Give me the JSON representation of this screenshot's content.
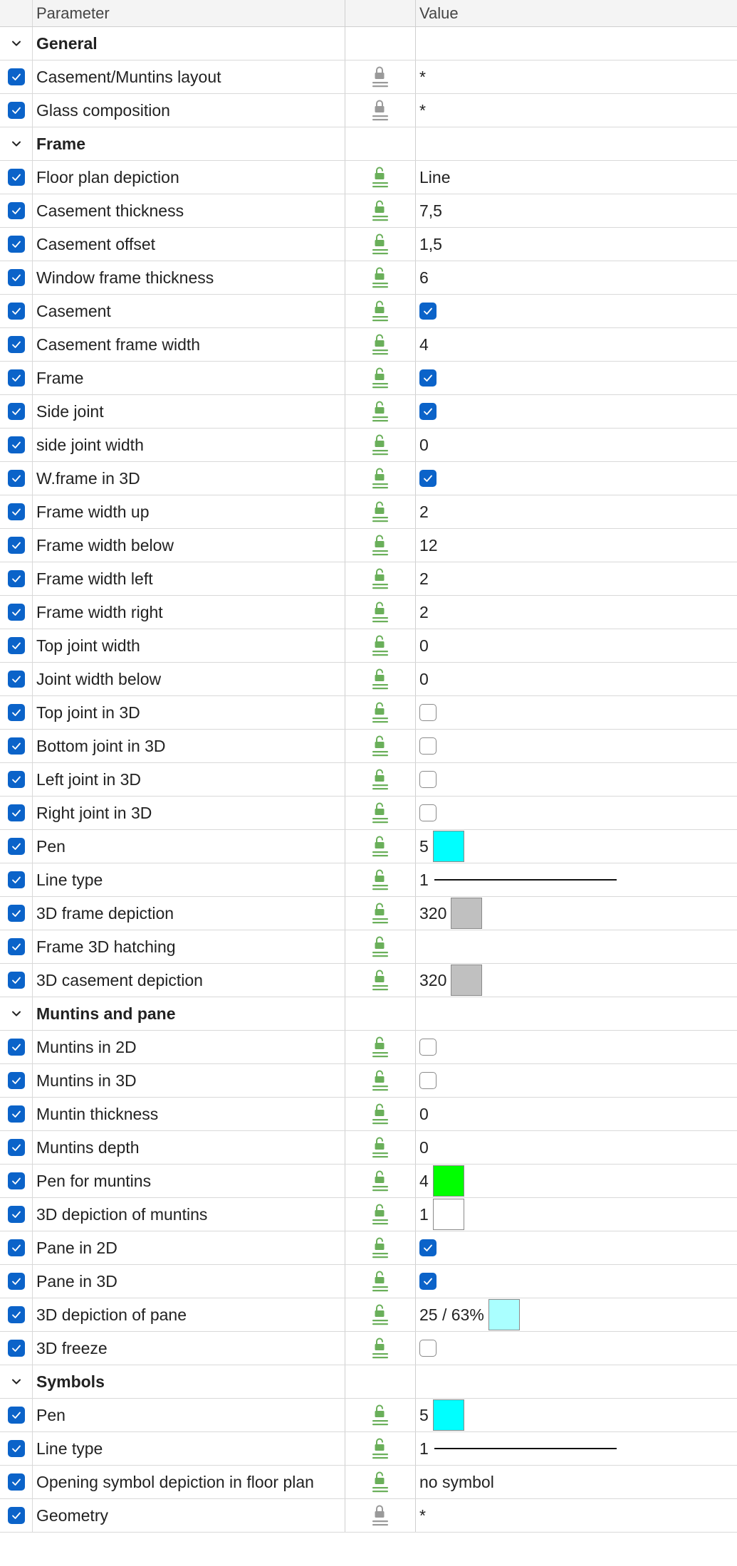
{
  "header": {
    "parameter": "Parameter",
    "value": "Value"
  },
  "colors": {
    "accent": "#0b63c9",
    "lock_unlocked": "#6aaf5a",
    "lock_locked": "#9a9a9a"
  },
  "rows": [
    {
      "kind": "group",
      "name": "General"
    },
    {
      "kind": "param",
      "name": "Casement/Muntins layout",
      "lock": "locked",
      "value": "*"
    },
    {
      "kind": "param",
      "name": "Glass composition",
      "lock": "locked",
      "value": "*"
    },
    {
      "kind": "group",
      "name": "Frame"
    },
    {
      "kind": "param",
      "name": "Floor plan depiction",
      "lock": "unlocked",
      "value": "Line"
    },
    {
      "kind": "param",
      "name": "Casement thickness",
      "lock": "unlocked",
      "value": "7,5"
    },
    {
      "kind": "param",
      "name": "Casement offset",
      "lock": "unlocked",
      "value": "1,5"
    },
    {
      "kind": "param",
      "name": "Window frame thickness",
      "lock": "unlocked",
      "value": "6"
    },
    {
      "kind": "param",
      "name": "Casement",
      "lock": "unlocked",
      "checkbox": true
    },
    {
      "kind": "param",
      "name": "Casement frame width",
      "lock": "unlocked",
      "value": "4"
    },
    {
      "kind": "param",
      "name": "Frame",
      "lock": "unlocked",
      "checkbox": true
    },
    {
      "kind": "param",
      "name": "Side joint",
      "lock": "unlocked",
      "checkbox": true
    },
    {
      "kind": "param",
      "name": "side joint width",
      "lock": "unlocked",
      "value": "0"
    },
    {
      "kind": "param",
      "name": "W.frame in 3D",
      "lock": "unlocked",
      "checkbox": true
    },
    {
      "kind": "param",
      "name": "Frame width up",
      "lock": "unlocked",
      "value": "2"
    },
    {
      "kind": "param",
      "name": "Frame width below",
      "lock": "unlocked",
      "value": "12"
    },
    {
      "kind": "param",
      "name": "Frame width left",
      "lock": "unlocked",
      "value": "2"
    },
    {
      "kind": "param",
      "name": "Frame width right",
      "lock": "unlocked",
      "value": "2"
    },
    {
      "kind": "param",
      "name": "Top joint width",
      "lock": "unlocked",
      "value": "0"
    },
    {
      "kind": "param",
      "name": "Joint width below",
      "lock": "unlocked",
      "value": "0"
    },
    {
      "kind": "param",
      "name": "Top joint in 3D",
      "lock": "unlocked",
      "checkbox": false
    },
    {
      "kind": "param",
      "name": "Bottom joint in 3D",
      "lock": "unlocked",
      "checkbox": false
    },
    {
      "kind": "param",
      "name": "Left joint in 3D",
      "lock": "unlocked",
      "checkbox": false
    },
    {
      "kind": "param",
      "name": "Right joint in 3D",
      "lock": "unlocked",
      "checkbox": false
    },
    {
      "kind": "param",
      "name": "Pen",
      "lock": "unlocked",
      "value": "5",
      "swatch": "#00ffff"
    },
    {
      "kind": "param",
      "name": "Line type",
      "lock": "unlocked",
      "value": "1",
      "line": true
    },
    {
      "kind": "param",
      "name": "3D frame depiction",
      "lock": "unlocked",
      "value": "320",
      "swatch": "#c0c0c0"
    },
    {
      "kind": "param",
      "name": "Frame 3D hatching",
      "lock": "unlocked",
      "value": ""
    },
    {
      "kind": "param",
      "name": "3D casement depiction",
      "lock": "unlocked",
      "value": "320",
      "swatch": "#c0c0c0"
    },
    {
      "kind": "group",
      "name": "Muntins and pane"
    },
    {
      "kind": "param",
      "name": "Muntins in 2D",
      "lock": "unlocked",
      "checkbox": false
    },
    {
      "kind": "param",
      "name": "Muntins in 3D",
      "lock": "unlocked",
      "checkbox": false
    },
    {
      "kind": "param",
      "name": "Muntin thickness",
      "lock": "unlocked",
      "value": "0"
    },
    {
      "kind": "param",
      "name": "Muntins depth",
      "lock": "unlocked",
      "value": "0"
    },
    {
      "kind": "param",
      "name": "Pen for muntins",
      "lock": "unlocked",
      "value": "4",
      "swatch": "#00ff00"
    },
    {
      "kind": "param",
      "name": "3D depiction of muntins",
      "lock": "unlocked",
      "value": "1",
      "swatch": "#ffffff"
    },
    {
      "kind": "param",
      "name": "Pane in 2D",
      "lock": "unlocked",
      "checkbox": true
    },
    {
      "kind": "param",
      "name": "Pane in 3D",
      "lock": "unlocked",
      "checkbox": true
    },
    {
      "kind": "param",
      "name": "3D depiction of pane",
      "lock": "unlocked",
      "value": "25 / 63%",
      "swatch": "#aaffff"
    },
    {
      "kind": "param",
      "name": "3D freeze",
      "lock": "unlocked",
      "checkbox": false
    },
    {
      "kind": "group",
      "name": "Symbols"
    },
    {
      "kind": "param",
      "name": "Pen",
      "lock": "unlocked",
      "value": "5",
      "swatch": "#00ffff"
    },
    {
      "kind": "param",
      "name": "Line type",
      "lock": "unlocked",
      "value": "1",
      "line": true
    },
    {
      "kind": "param",
      "name": "Opening symbol depiction in floor plan",
      "lock": "unlocked",
      "value": "no symbol"
    },
    {
      "kind": "param",
      "name": "Geometry",
      "lock": "locked",
      "value": "*"
    }
  ]
}
